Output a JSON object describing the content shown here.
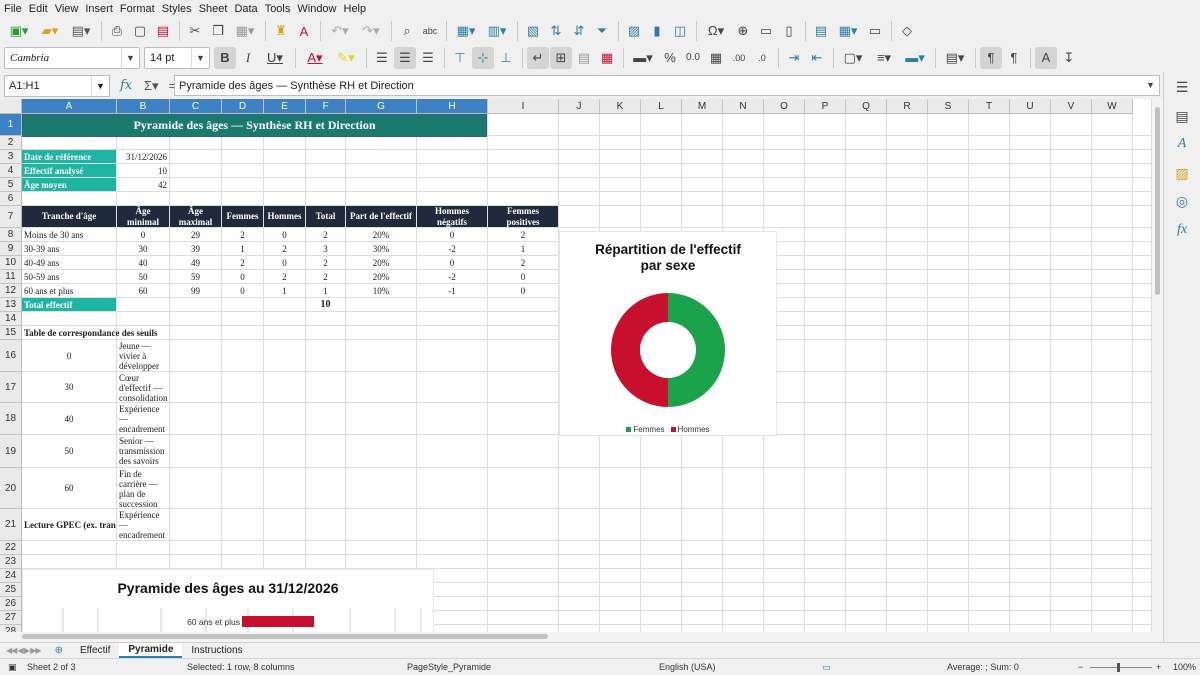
{
  "menu": [
    "File",
    "Edit",
    "View",
    "Insert",
    "Format",
    "Styles",
    "Sheet",
    "Data",
    "Tools",
    "Window",
    "Help"
  ],
  "toolbar": {
    "font_name": "Cambria",
    "font_size": "14 pt"
  },
  "formula_bar": {
    "cell_ref": "A1:H1",
    "content": "Pyramide des âges — Synthèse RH et Direction"
  },
  "columns": [
    "A",
    "B",
    "C",
    "D",
    "E",
    "F",
    "G",
    "H",
    "I",
    "J",
    "K",
    "L",
    "M",
    "N",
    "O",
    "P",
    "Q",
    "R",
    "S",
    "T",
    "U",
    "V",
    "W"
  ],
  "rows": [
    "1",
    "2",
    "3",
    "4",
    "5",
    "6",
    "7",
    "8",
    "9",
    "10",
    "11",
    "12",
    "13",
    "14",
    "15",
    "16",
    "17",
    "18",
    "19",
    "20",
    "21",
    "22",
    "23",
    "24",
    "25",
    "26",
    "27",
    "28"
  ],
  "sheet": {
    "title": "Pyramide des âges — Synthèse RH et Direction",
    "summary": [
      {
        "label": "Date de référence",
        "value": "31/12/2026"
      },
      {
        "label": "Effectif analysé",
        "value": "10"
      },
      {
        "label": "Âge moyen",
        "value": "42"
      }
    ],
    "table_headers": [
      "Tranche d'âge",
      "Âge minimal",
      "Âge maximal",
      "Femmes",
      "Hommes",
      "Total",
      "Part de l'effectif",
      "Hommes négatifs",
      "Femmes positives"
    ],
    "table_rows": [
      [
        "Moins de 30 ans",
        "0",
        "29",
        "2",
        "0",
        "2",
        "20%",
        "0",
        "2"
      ],
      [
        "30-39 ans",
        "30",
        "39",
        "1",
        "2",
        "3",
        "30%",
        "-2",
        "1"
      ],
      [
        "40-49 ans",
        "40",
        "49",
        "2",
        "0",
        "2",
        "20%",
        "0",
        "2"
      ],
      [
        "50-59 ans",
        "50",
        "59",
        "0",
        "2",
        "2",
        "20%",
        "-2",
        "0"
      ],
      [
        "60 ans et plus",
        "60",
        "99",
        "0",
        "1",
        "1",
        "10%",
        "-1",
        "0"
      ]
    ],
    "total_label": "Total effectif",
    "total_value": "10",
    "thresholds_title": "Table de correspondance des seuils",
    "thresholds": [
      {
        "age": "0",
        "label": "Jeune — vivier à développer"
      },
      {
        "age": "30",
        "label": "Cœur d'effectif — consolidation"
      },
      {
        "age": "40",
        "label": "Expérience — encadrement"
      },
      {
        "age": "50",
        "label": "Senior — transmission des savoirs"
      },
      {
        "age": "60",
        "label": "Fin de carrière — plan de succession"
      }
    ],
    "gpec_label": "Lecture GPEC (ex. tranc",
    "gpec_value": "Expérience — encadrement"
  },
  "chart_data": [
    {
      "type": "pie",
      "title": "Répartition de l'effectif par sexe",
      "categories": [
        "Femmes",
        "Hommes"
      ],
      "values": [
        5,
        5
      ],
      "colors": [
        "#1aa34a",
        "#c8102e"
      ],
      "legend": "bottom"
    },
    {
      "type": "bar",
      "title": "Pyramide des âges au 31/12/2026",
      "categories": [
        "60 ans et plus"
      ],
      "series": [
        {
          "values": [
            -1
          ],
          "color": "#c8102e"
        }
      ]
    }
  ],
  "tabs": [
    "Effectif",
    "Pyramide",
    "Instructions"
  ],
  "active_tab": "Pyramide",
  "status": {
    "sheet": "Sheet 2 of 3",
    "selection": "Selected: 1 row, 8 columns",
    "page_style": "PageStyle_Pyramide",
    "language": "English (USA)",
    "summary": "Average: ; Sum: 0",
    "zoom": "100%"
  },
  "colors": {
    "title_bg": "#1a7a6e",
    "teal": "#1fb5a3",
    "header_dark": "#1f2b3c",
    "selection": "#3d81c5"
  }
}
